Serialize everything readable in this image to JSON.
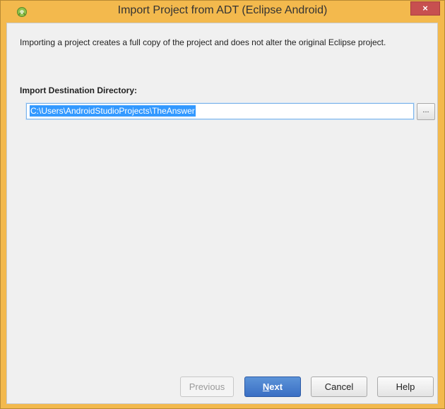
{
  "window": {
    "title": "Import Project from ADT (Eclipse Android)",
    "close_label": "×",
    "accent_color": "#f3b94d"
  },
  "content": {
    "description": "Importing a project creates a full copy of the project and does not alter the original Eclipse project.",
    "destination_label": "Import Destination Directory:",
    "destination_value": "C:\\Users\\AndroidStudioProjects\\TheAnswer",
    "browse_label": "..."
  },
  "buttons": {
    "previous_label": "Previous",
    "next_mnemonic": "N",
    "next_rest": "ext",
    "cancel_label": "Cancel",
    "help_label": "Help"
  },
  "icons": {
    "app": "android-studio-icon",
    "close": "close-icon"
  }
}
